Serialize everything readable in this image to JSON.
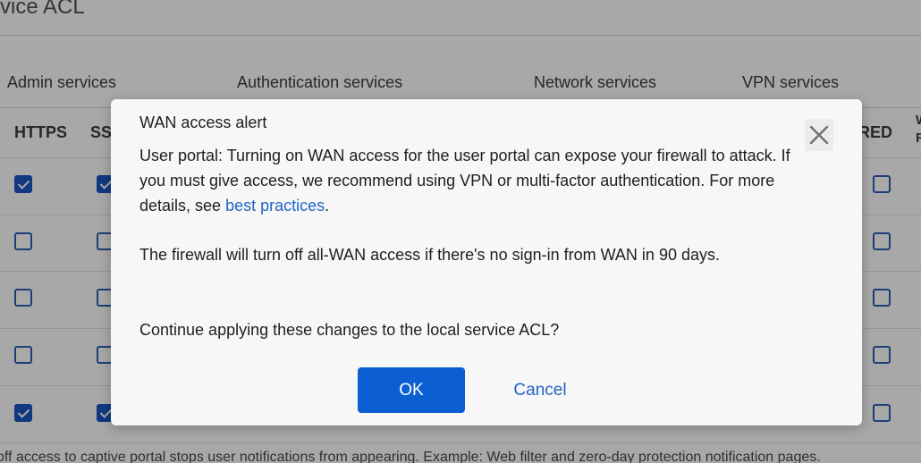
{
  "background": {
    "page_title": "rvice ACL",
    "groups": {
      "admin": "Admin services",
      "authentication": "Authentication services",
      "network": "Network services",
      "vpn": "VPN services"
    },
    "columns": {
      "https": "HTTPS",
      "ssh": "SS",
      "red": "RED",
      "edge_top": "W",
      "edge_bottom": "R"
    },
    "rows": [
      {
        "https": true,
        "ssh": true,
        "red": false
      },
      {
        "https": false,
        "ssh": false,
        "red": false
      },
      {
        "https": false,
        "ssh": false,
        "red": false
      },
      {
        "https": false,
        "ssh": false,
        "red": false
      },
      {
        "https": true,
        "ssh": true,
        "red": false
      }
    ],
    "footer_note": "off access to captive portal stops user notifications from appearing. Example: Web filter and zero-day protection notification pages."
  },
  "dialog": {
    "title": "WAN access alert",
    "close_icon": "close-icon",
    "message": {
      "part1": "User portal: Turning on WAN access for the user portal can expose your firewall to attack. If you must give access, we recommend using VPN or multi-factor authentication. For more details, see ",
      "link_text": "best practices",
      "part1_end": "."
    },
    "message2": "The firewall will turn off all-WAN access if there's no sign-in from WAN in 90 days.",
    "message3": "Continue applying these changes to the local service ACL?",
    "ok_label": "OK",
    "cancel_label": "Cancel"
  },
  "colors": {
    "overlay": "#000000",
    "primary_button": "#0b5fd3",
    "link": "#1f65c6",
    "checkbox": "#1a56c4"
  }
}
